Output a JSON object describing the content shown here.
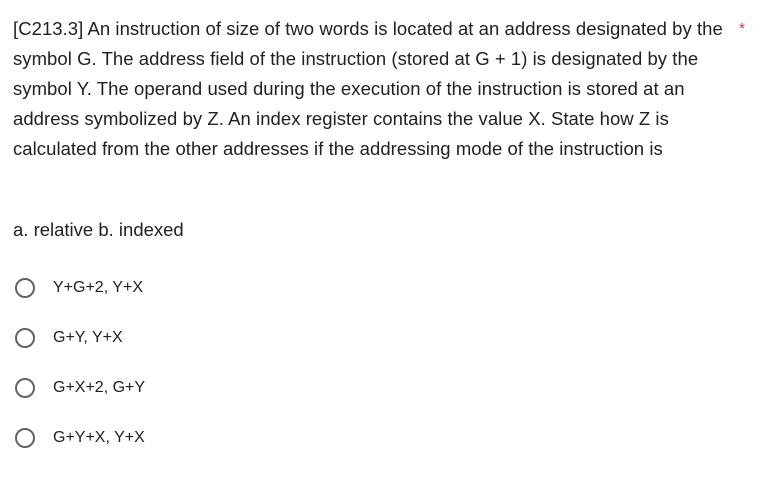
{
  "question": {
    "text": "[C213.3] An instruction of size of two words is located at an address designated by the symbol G. The address field of the instruction (stored at G + 1) is designated by the symbol Y. The operand used during the execution of the instruction is stored at an address symbolized by Z. An index register contains the value X. State how Z is calculated from the other addresses if the addressing mode of the instruction is",
    "required_marker": "*",
    "sub_text": "a. relative b. indexed"
  },
  "options": [
    {
      "label": "Y+G+2, Y+X",
      "selected": false
    },
    {
      "label": "G+Y, Y+X",
      "selected": false
    },
    {
      "label": "G+X+2, G+Y",
      "selected": false
    },
    {
      "label": "G+Y+X, Y+X",
      "selected": false
    }
  ],
  "colors": {
    "text": "#202124",
    "radio_border": "#5f6368",
    "required": "#d93025"
  }
}
